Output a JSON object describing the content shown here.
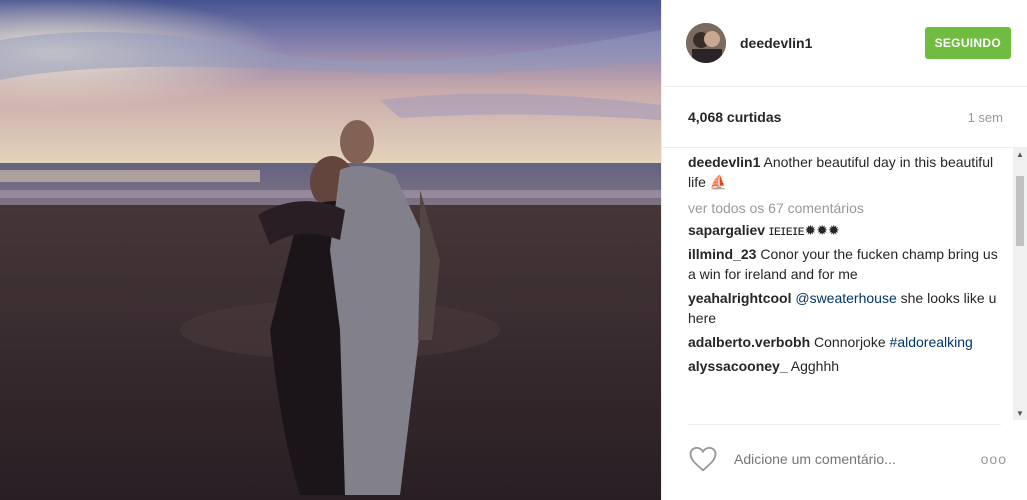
{
  "post": {
    "username": "deedevlin1",
    "follow_label": "SEGUINDO",
    "likes": "4,068 curtidas",
    "time": "1 sem",
    "caption": {
      "user": "deedevlin1",
      "text": " Another beautiful day in this beautiful life ",
      "emoji": "⛵"
    },
    "view_all": "ver todos os 67 comentários",
    "comments": [
      {
        "user": "sapargaliev",
        "text": " ɪᴇɪᴇɪᴇ✹✹✹"
      },
      {
        "user": "illmind_23",
        "text": " Conor your the fucken champ bring us a win for ireland and for me"
      },
      {
        "user": "yeahalrightcool",
        "tag": " @sweaterhouse",
        "text": " she looks like u here"
      },
      {
        "user": "adalberto.verbobh",
        "text": " Connorjoke ",
        "hashtag": "#aldorealking"
      },
      {
        "user": "alyssacooney_",
        "text": " Agghhh"
      }
    ],
    "add_comment_placeholder": "Adicione um comentário...",
    "more_label": "ooo"
  },
  "colors": {
    "follow": "#6fbc41",
    "link": "#003569"
  },
  "icons": {
    "like": "heart-icon",
    "more": "more-options-icon"
  }
}
